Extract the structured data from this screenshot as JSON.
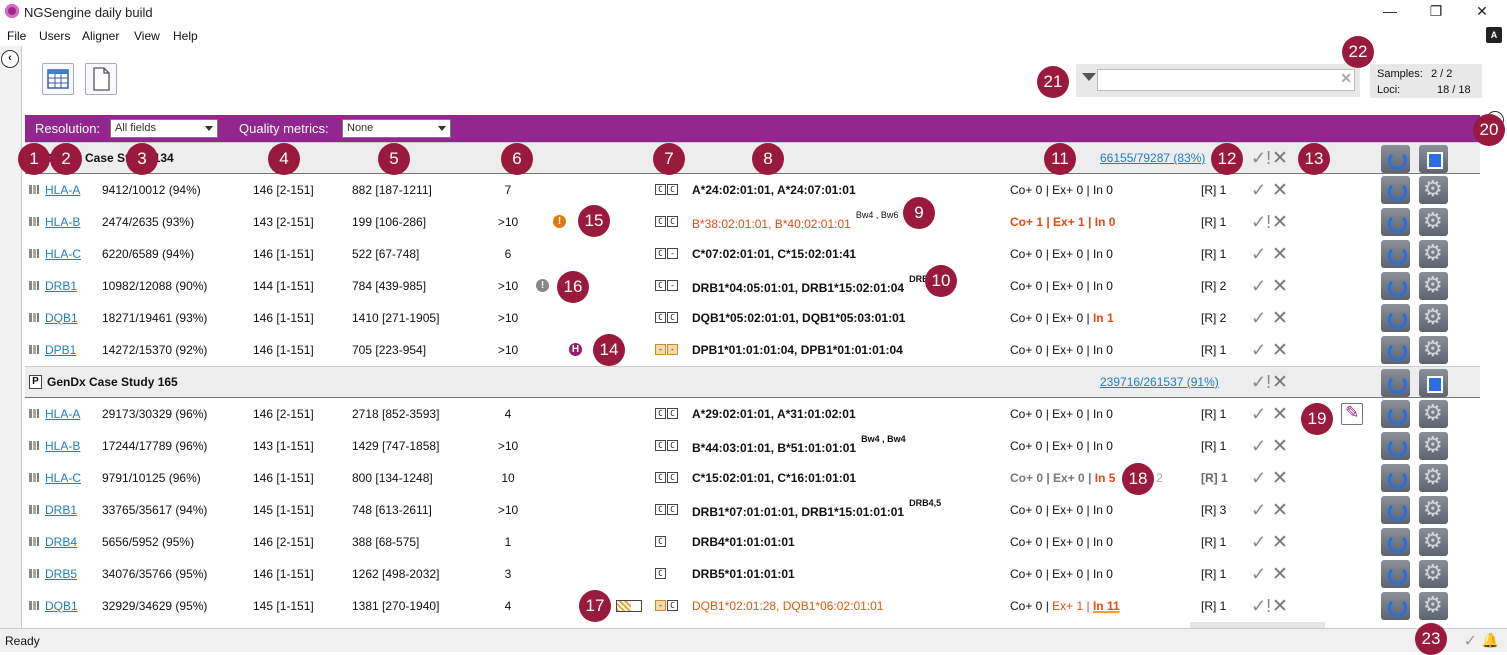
{
  "window": {
    "title": "NGSengine daily build",
    "minimize": "—",
    "restore": "❐",
    "close": "✕"
  },
  "menu": [
    "File",
    "Users",
    "Aligner",
    "View",
    "Help"
  ],
  "filter": {
    "value": "",
    "placeholder": ""
  },
  "stats": {
    "samples_label": "Samples:",
    "samples_value": "2 / 2",
    "loci_label": "Loci:",
    "loci_value": "18 / 18"
  },
  "band": {
    "resolution_label": "Resolution:",
    "resolution_value": "All fields",
    "quality_label": "Quality metrics:",
    "quality_value": "None"
  },
  "samples": [
    {
      "name": "GenDx Case Study 134",
      "reads": "66155/79287 (83%)"
    },
    {
      "name": "GenDx Case Study 165",
      "reads": "239716/261537 (91%)"
    }
  ],
  "rows": [
    {
      "locus": "HLA-A",
      "reads": "9412/10012 (94%)",
      "cov": "146 [2-151]",
      "len": "882 [187-1211]",
      "amb": "7",
      "typing": "A*24:02:01:01, A*24:07:01:01",
      "sup": "",
      "m1": "Co+ 0 | Ex+ 0 | In 0",
      "r": "[R] 1"
    },
    {
      "locus": "HLA-B",
      "reads": "2474/2635 (93%)",
      "cov": "143 [2-151]",
      "len": "199 [106-286]",
      "amb": ">10",
      "typing": "B*38:02:01:01, B*40:02:01:01",
      "sup": "Bw4 , Bw6",
      "m1": "Co+ 1 | Ex+ 1 | In 0",
      "r": "[R] 1"
    },
    {
      "locus": "HLA-C",
      "reads": "6220/6589 (94%)",
      "cov": "146 [1-151]",
      "len": "522 [67-748]",
      "amb": "6",
      "typing": "C*07:02:01:01, C*15:02:01:41",
      "sup": "",
      "m1": "Co+ 0 | Ex+ 0 | In 0",
      "r": "[R] 1"
    },
    {
      "locus": "DRB1",
      "reads": "10982/12088 (90%)",
      "cov": "144 [1-151]",
      "len": "784 [439-985]",
      "amb": ">10",
      "typing": "DRB1*04:05:01:01, DRB1*15:02:01:04",
      "sup": "DRB4,5",
      "m1": "Co+ 0 | Ex+ 0 | In 0",
      "r": "[R] 2"
    },
    {
      "locus": "DQB1",
      "reads": "18271/19461 (93%)",
      "cov": "146 [1-151]",
      "len": "1410 [271-1905]",
      "amb": ">10",
      "typing": "DQB1*05:02:01:01, DQB1*05:03:01:01",
      "sup": "",
      "m1": "Co+ 0 | Ex+ 0 | ",
      "m1b": "In 1",
      "r": "[R] 2"
    },
    {
      "locus": "DPB1",
      "reads": "14272/15370 (92%)",
      "cov": "146 [1-151]",
      "len": "705 [223-954]",
      "amb": ">10",
      "typing": "DPB1*01:01:01:04, DPB1*01:01:01:04",
      "sup": "",
      "m1": "Co+ 0 | Ex+ 0 | In 0",
      "r": "[R] 1"
    },
    {
      "locus": "HLA-A",
      "reads": "29173/30329 (96%)",
      "cov": "146 [2-151]",
      "len": "2718 [852-3593]",
      "amb": "4",
      "typing": "A*29:02:01:01, A*31:01:02:01",
      "sup": "",
      "m1": "Co+ 0 | Ex+ 0 | In 0",
      "r": "[R] 1"
    },
    {
      "locus": "HLA-B",
      "reads": "17244/17789 (96%)",
      "cov": "143 [1-151]",
      "len": "1429 [747-1858]",
      "amb": ">10",
      "typing": "B*44:03:01:01, B*51:01:01:01",
      "sup": "Bw4 , Bw4",
      "m1": "Co+ 0 | Ex+ 0 | In 0",
      "r": "[R] 1"
    },
    {
      "locus": "HLA-C",
      "reads": "9791/10125 (96%)",
      "cov": "146 [1-151]",
      "len": "800 [134-1248]",
      "amb": "10",
      "typing": "C*15:02:01:01, C*16:01:01:01",
      "sup": "",
      "m1": "Co+ 0 | Ex+ 0 | ",
      "m1b": "In 5",
      "extra": "[?] 2",
      "r": "[R] 1"
    },
    {
      "locus": "DRB1",
      "reads": "33765/35617 (94%)",
      "cov": "145 [1-151]",
      "len": "748 [613-2611]",
      "amb": ">10",
      "typing": "DRB1*07:01:01:01, DRB1*15:01:01:01",
      "sup": "DRB4,5",
      "m1": "Co+ 0 | Ex+ 0 | In 0",
      "r": "[R] 3"
    },
    {
      "locus": "DRB4",
      "reads": "5656/5952 (95%)",
      "cov": "146 [2-151]",
      "len": "388 [68-575]",
      "amb": "1",
      "typing": "DRB4*01:01:01:01",
      "sup": "",
      "m1": "Co+ 0 | Ex+ 0 | In 0",
      "r": "[R] 1"
    },
    {
      "locus": "DRB5",
      "reads": "34076/35766 (95%)",
      "cov": "146 [1-151]",
      "len": "1262 [498-2032]",
      "amb": "3",
      "typing": "DRB5*01:01:01:01",
      "sup": "",
      "m1": "Co+ 0 | Ex+ 0 | In 0",
      "r": "[R] 1"
    },
    {
      "locus": "DQB1",
      "reads": "32929/34629 (95%)",
      "cov": "145 [1-151]",
      "len": "1381 [270-1940]",
      "amb": "4",
      "typing": "DQB1*02:01:28, DQB1*06:02:01:01",
      "sup": "",
      "m1": "Co+ 0 | ",
      "m1b": "Ex+ 1 | ",
      "m1c": "In 11",
      "r": "[R] 1"
    }
  ],
  "cc": {
    "C": "C",
    "dot": "-"
  },
  "callouts": [
    "1",
    "2",
    "3",
    "4",
    "5",
    "6",
    "7",
    "8",
    "9",
    "10",
    "11",
    "12",
    "13",
    "14",
    "15",
    "16",
    "17",
    "18",
    "19",
    "20",
    "21",
    "22",
    "23"
  ],
  "icons": {
    "check": "✓",
    "cross": "✕",
    "check_warn": "✓!",
    "warn": "!",
    "homo": "H"
  },
  "status": {
    "text": "Ready"
  },
  "colors": {
    "brand_purple": "#92278f",
    "callout": "#9a1a3e",
    "link": "#1a7fc9",
    "warn_red": "#e24b17"
  }
}
